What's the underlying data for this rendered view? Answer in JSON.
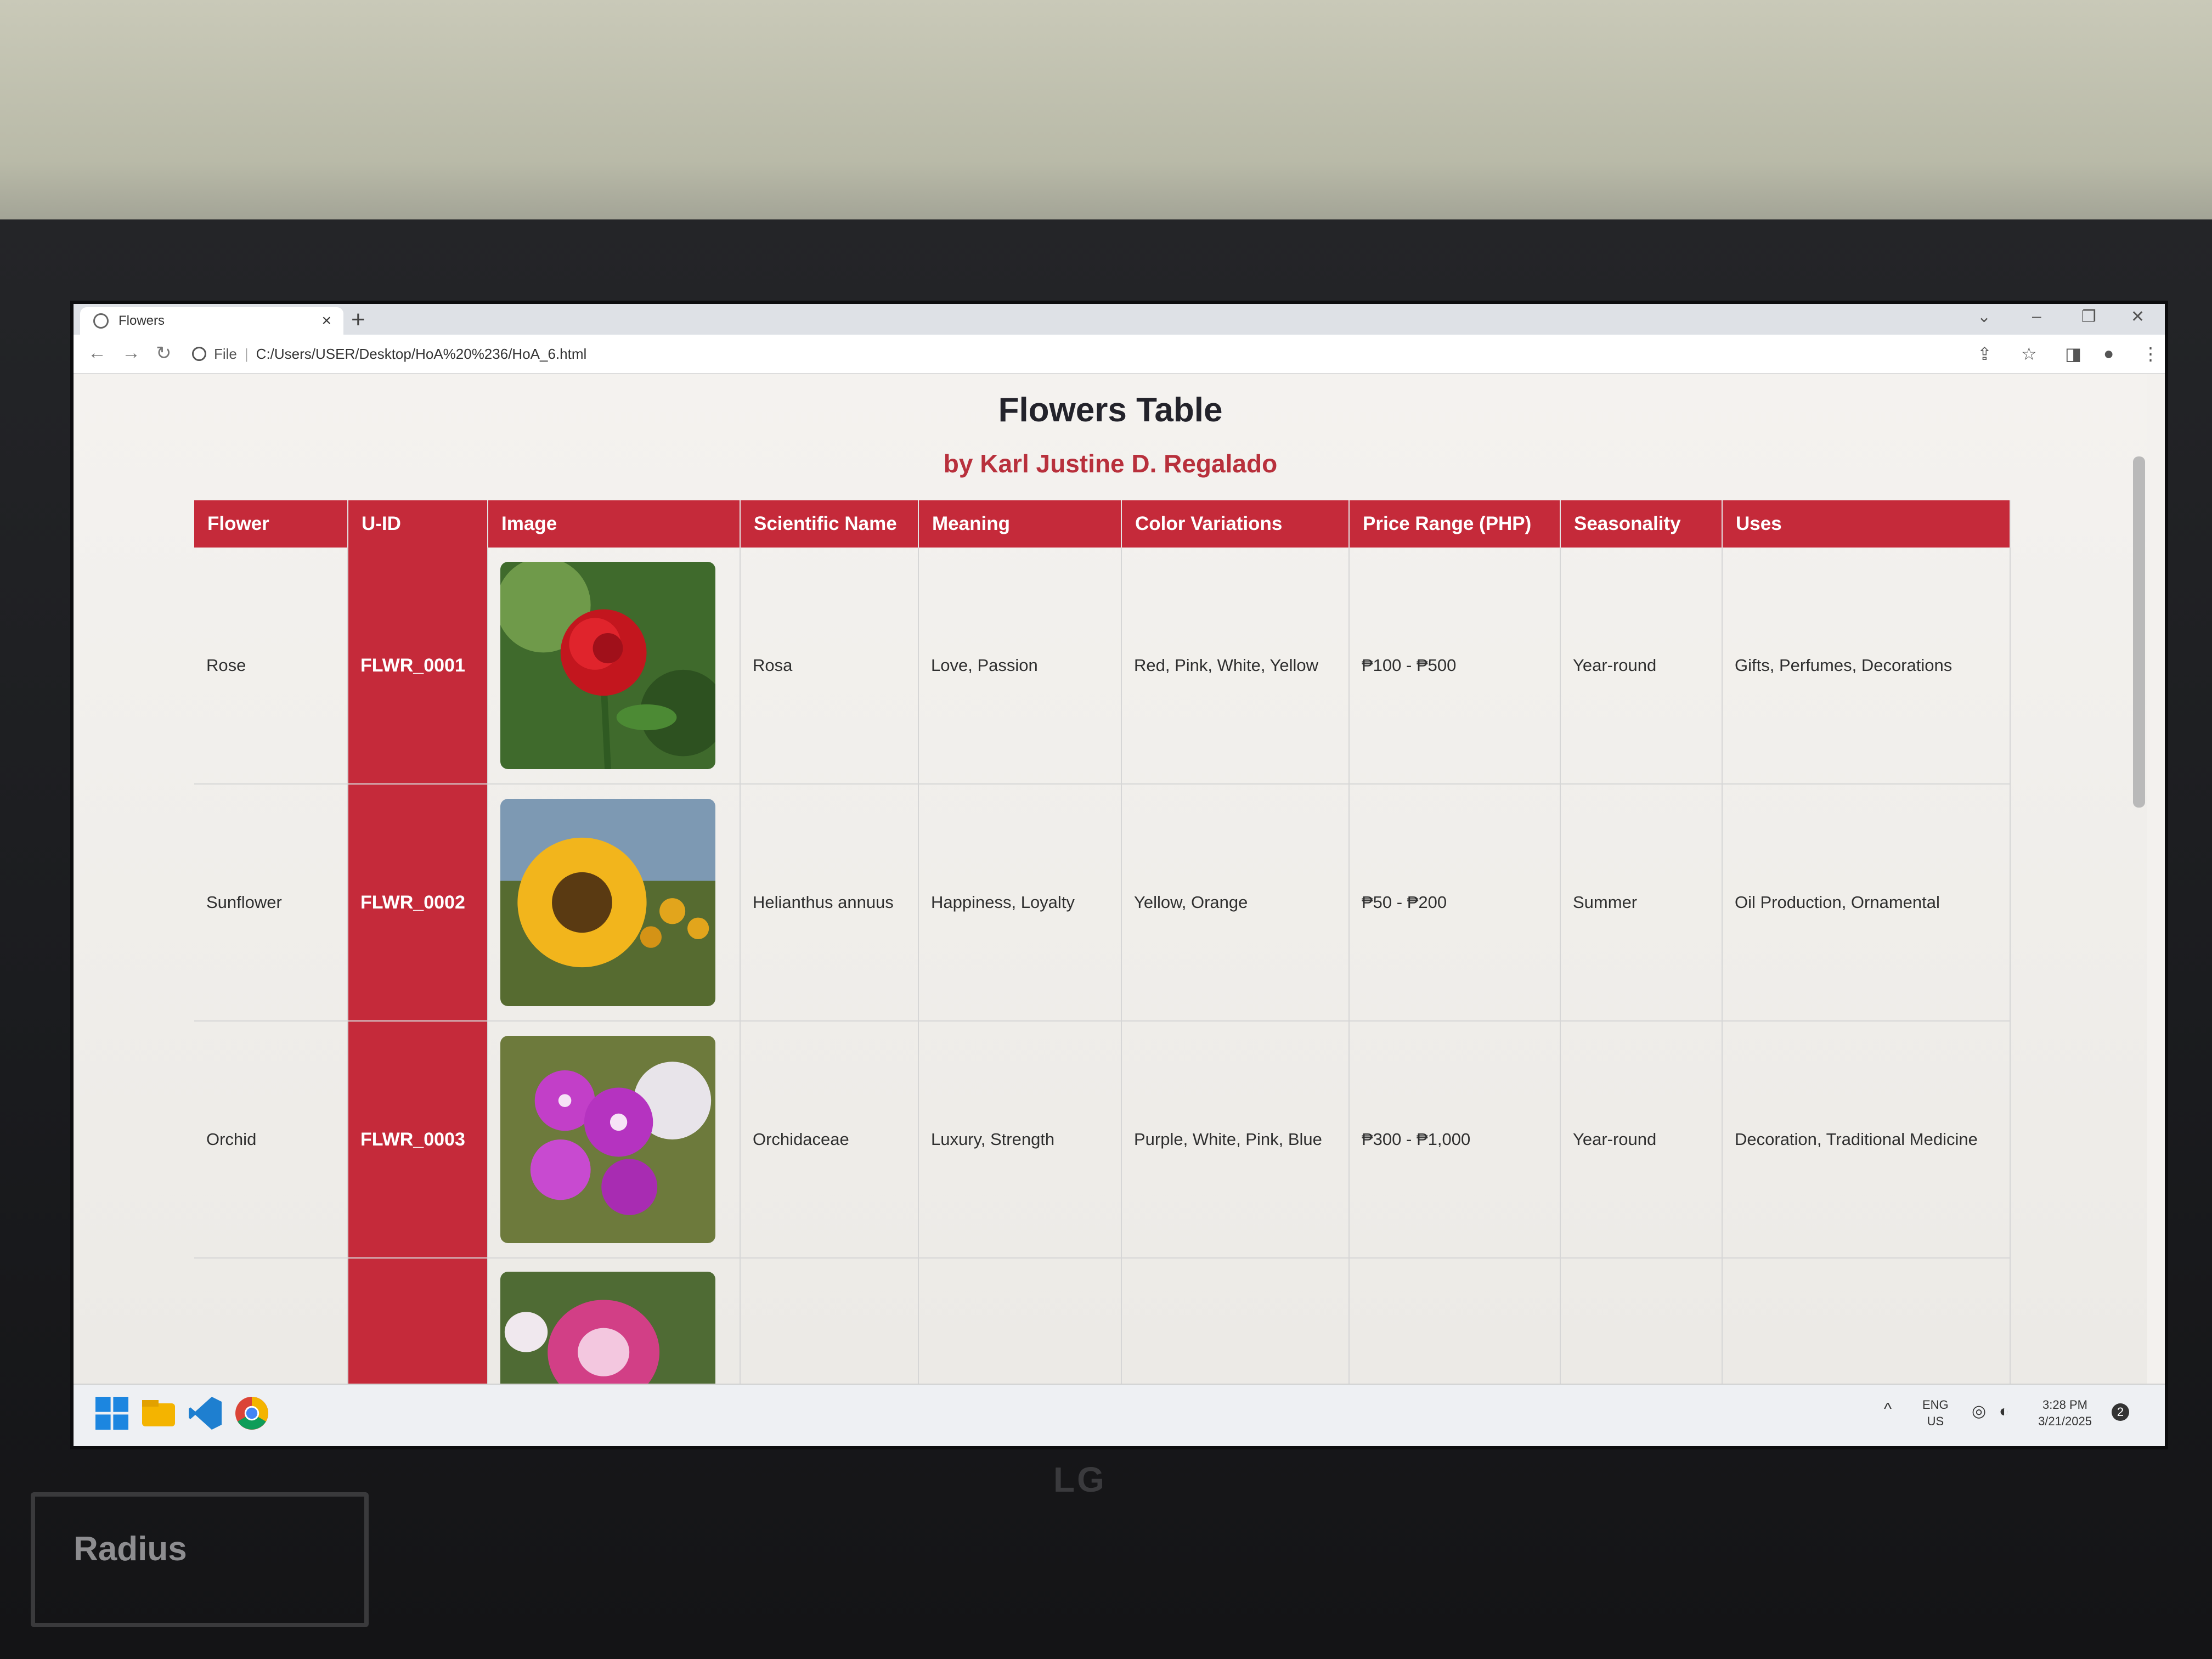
{
  "browser": {
    "tab_title": "Flowers",
    "url_scheme": "File",
    "url": "C:/Users/USER/Desktop/HoA%20%236/HoA_6.html"
  },
  "page": {
    "title": "Flowers Table",
    "subtitle": "by Karl Justine D. Regalado"
  },
  "table": {
    "headers": [
      "Flower",
      "U-ID",
      "Image",
      "Scientific Name",
      "Meaning",
      "Color Variations",
      "Price Range (PHP)",
      "Seasonality",
      "Uses"
    ],
    "rows": [
      {
        "flower": "Rose",
        "uid": "FLWR_0001",
        "image": "rose-photo",
        "scientific": "Rosa",
        "meaning": "Love, Passion",
        "colors": "Red, Pink, White, Yellow",
        "price": "₱100 - ₱500",
        "season": "Year-round",
        "uses": "Gifts, Perfumes, Decorations"
      },
      {
        "flower": "Sunflower",
        "uid": "FLWR_0002",
        "image": "sunflower-photo",
        "scientific": "Helianthus annuus",
        "meaning": "Happiness, Loyalty",
        "colors": "Yellow, Orange",
        "price": "₱50 - ₱200",
        "season": "Summer",
        "uses": "Oil Production, Ornamental"
      },
      {
        "flower": "Orchid",
        "uid": "FLWR_0003",
        "image": "orchid-photo",
        "scientific": "Orchidaceae",
        "meaning": "Luxury, Strength",
        "colors": "Purple, White, Pink, Blue",
        "price": "₱300 - ₱1,000",
        "season": "Year-round",
        "uses": "Decoration, Traditional Medicine"
      }
    ]
  },
  "taskbar": {
    "lang": "ENG",
    "region": "US",
    "time": "3:28 PM",
    "date": "3/21/2025",
    "notifications": "2"
  },
  "hardware": {
    "monitor_brand": "LG",
    "sticker_label": "Radius"
  },
  "colors": {
    "header_red": "#c52a3a",
    "subtitle_red": "#b8303c"
  }
}
